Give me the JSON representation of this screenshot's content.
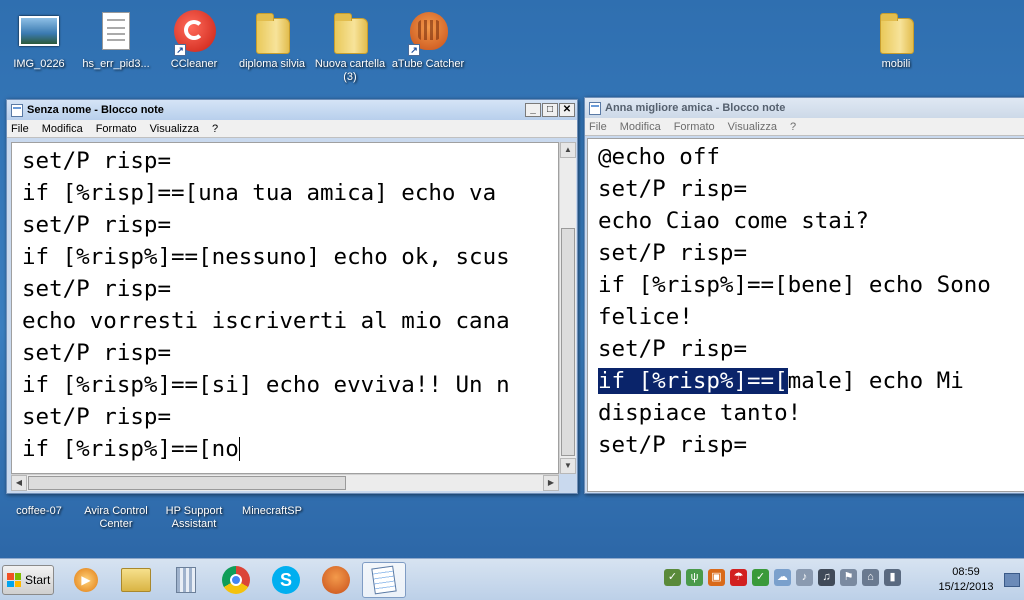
{
  "desktop": {
    "icons_top": [
      {
        "label": "IMG_0226",
        "icon": "image-icon"
      },
      {
        "label": "hs_err_pid3...",
        "icon": "text-file-icon"
      },
      {
        "label": "CCleaner",
        "icon": "ccleaner-icon"
      },
      {
        "label": "diploma silvia",
        "icon": "folder-icon"
      },
      {
        "label": "Nuova cartella (3)",
        "icon": "folder-icon"
      },
      {
        "label": "aTube Catcher",
        "icon": "atube-catcher-icon"
      },
      {
        "label": "mobili",
        "icon": "folder-icon"
      }
    ],
    "icons_bottom": [
      {
        "label": "coffee-07"
      },
      {
        "label": "Avira Control Center"
      },
      {
        "label": "HP Support Assistant"
      },
      {
        "label": "MinecraftSP"
      }
    ]
  },
  "window_left": {
    "title": "Senza nome - Blocco note",
    "menu": [
      "File",
      "Modifica",
      "Formato",
      "Visualizza",
      "?"
    ],
    "lines": [
      "set/P risp=",
      "if [%risp]==[una tua amica] echo va",
      "set/P risp=",
      "if [%risp%]==[nessuno] echo ok, scus",
      "set/P risp=",
      "echo vorresti iscriverti al mio cana",
      "set/P risp=",
      "if [%risp%]==[si] echo evviva!! Un n",
      "set/P risp=",
      "if [%risp%]==[no"
    ]
  },
  "window_right": {
    "title": "Anna migliore amica - Blocco note",
    "menu": [
      "File",
      "Modifica",
      "Formato",
      "Visualizza",
      "?"
    ],
    "lines": [
      "@echo off",
      "set/P risp=",
      "echo Ciao come stai?",
      "set/P risp=",
      "if [%risp%]==[bene] echo Sono",
      "felice!",
      "set/P risp="
    ],
    "selected_text": "if [%risp%]==[",
    "selected_rest": "male] echo Mi",
    "after_lines": [
      "dispiace tanto!",
      "set/P risp="
    ]
  },
  "taskbar": {
    "start_label": "Start",
    "clock_time": "08:59",
    "clock_date": "15/12/2013"
  }
}
